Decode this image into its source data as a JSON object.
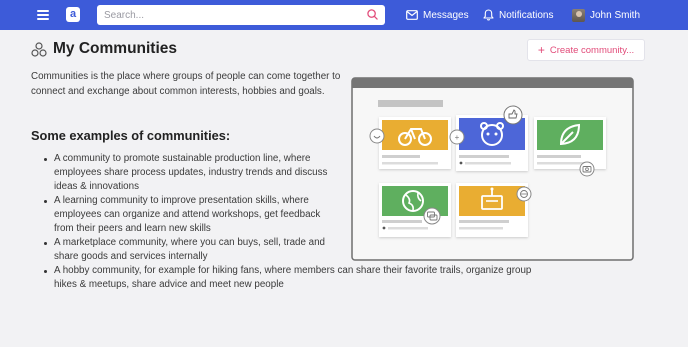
{
  "header": {
    "search_placeholder": "Search...",
    "nav": {
      "messages": "Messages",
      "notifications": "Notifications",
      "user_name": "John Smith"
    },
    "logo_letter": "a",
    "brand_color": "#3d5bd9"
  },
  "page": {
    "title": "My Communities",
    "create_button_label": "Create community..."
  },
  "intro": "Communities is the place where groups of people can come together to connect and exchange about common interests, hobbies and goals.",
  "examples": {
    "heading": "Some examples of communities:",
    "items": [
      "A community to promote sustainable production line, where employees share process updates, industry trends and discuss ideas & innovations",
      "A learning community to improve presentation skills, where employees can organize and attend workshops, get feedback from their peers and learn new skills",
      "A marketplace community, where you can buys, sell, trade and share goods and services internally",
      "A hobby community, for example for hiking fans, where members can share their favorite trails, organize group hikes & meetups, share advice and meet new people"
    ]
  },
  "icons": {
    "menu": "hamburger-icon",
    "search": "search-icon",
    "messages": "mail-icon",
    "notifications": "bell-icon",
    "communities": "communities-icon",
    "create": "plus-icon"
  },
  "colors": {
    "accent": "#e24c7a",
    "card_yellow": "#e9ad32",
    "card_blue": "#4d66d8",
    "card_green": "#5faf5f"
  }
}
